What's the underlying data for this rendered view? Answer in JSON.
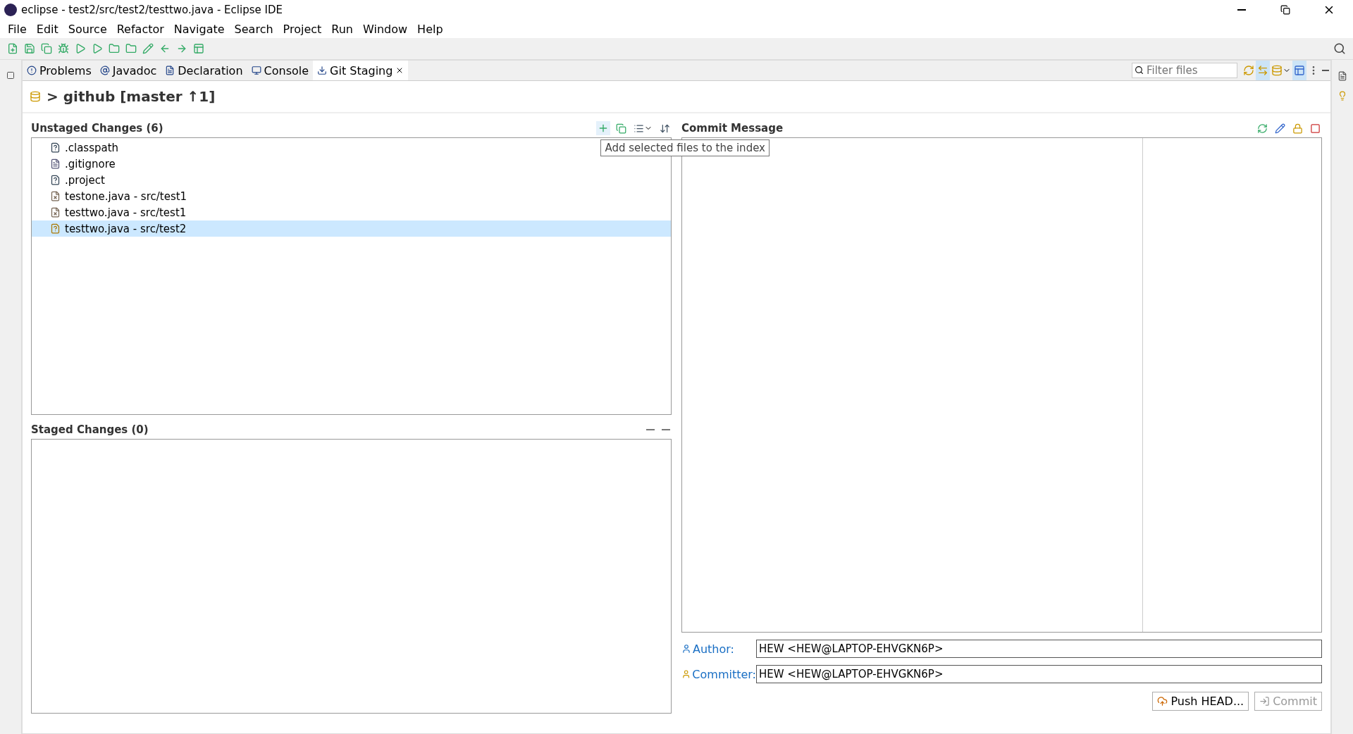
{
  "window": {
    "title": "eclipse - test2/src/test2/testtwo.java - Eclipse IDE"
  },
  "menu": [
    "File",
    "Edit",
    "Source",
    "Refactor",
    "Navigate",
    "Search",
    "Project",
    "Run",
    "Window",
    "Help"
  ],
  "tabs": [
    {
      "label": "Problems",
      "selected": false,
      "closable": false
    },
    {
      "label": "Javadoc",
      "selected": false,
      "closable": false
    },
    {
      "label": "Declaration",
      "selected": false,
      "closable": false
    },
    {
      "label": "Console",
      "selected": false,
      "closable": false
    },
    {
      "label": "Git Staging",
      "selected": true,
      "closable": true
    }
  ],
  "filter": {
    "placeholder": "Filter files"
  },
  "repository": {
    "label": "> github [master ↑1]"
  },
  "unstaged": {
    "title": "Unstaged Changes (6)",
    "files": [
      {
        "name": ".classpath",
        "kind": "unknown",
        "selected": false
      },
      {
        "name": ".gitignore",
        "kind": "text",
        "selected": false
      },
      {
        "name": ".project",
        "kind": "unknown",
        "selected": false
      },
      {
        "name": "testone.java - src/test1",
        "kind": "removed",
        "selected": false
      },
      {
        "name": "testtwo.java - src/test1",
        "kind": "removed",
        "selected": false
      },
      {
        "name": "testtwo.java - src/test2",
        "kind": "untracked",
        "selected": true
      }
    ]
  },
  "tooltip": "Add selected files to the index",
  "staged": {
    "title": "Staged Changes (0)"
  },
  "commit": {
    "title": "Commit Message",
    "author_label": "Author:",
    "author": "HEW <HEW@LAPTOP-EHVGKN6P>",
    "committer_label": "Committer:",
    "committer": "HEW <HEW@LAPTOP-EHVGKN6P>",
    "buttons": [
      {
        "label": "Push HEAD...",
        "disabled": false
      },
      {
        "label": "Commit",
        "disabled": true
      }
    ]
  }
}
